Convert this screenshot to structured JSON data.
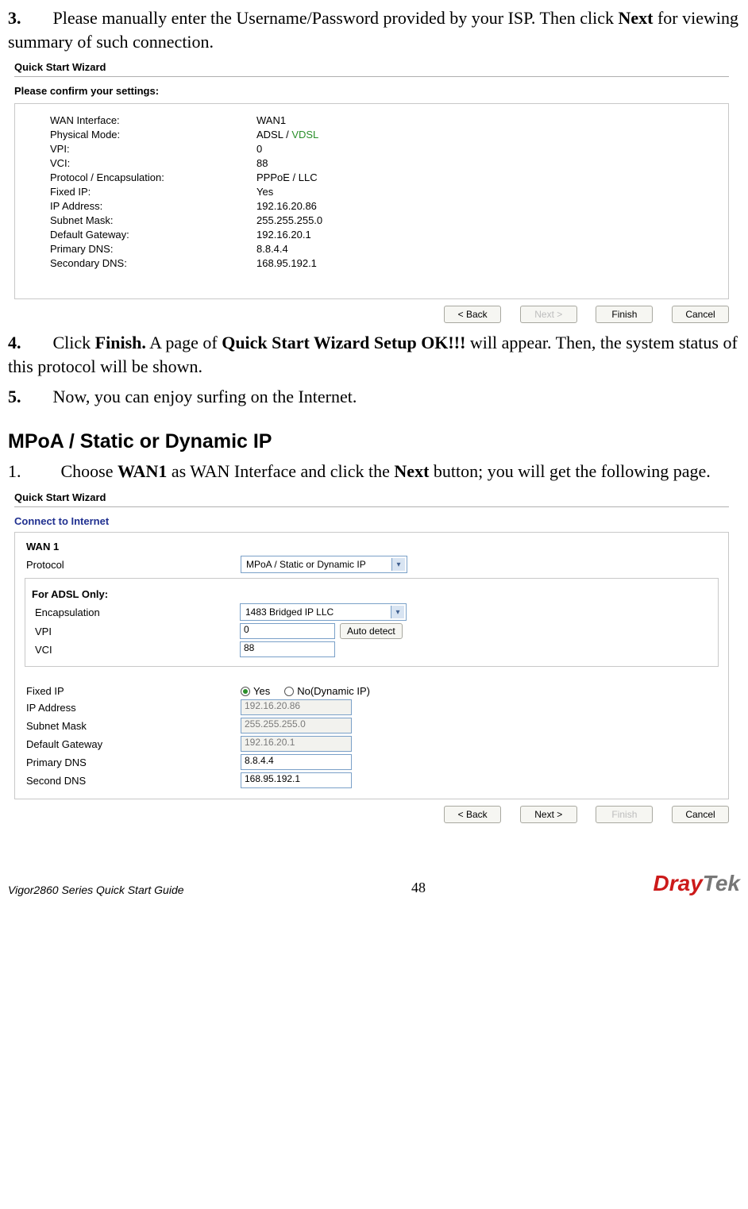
{
  "step3": {
    "num": "3.",
    "text_a": "Please manually enter the Username/Password provided by your ISP. Then click ",
    "bold": "Next",
    "text_b": " for viewing summary of such connection."
  },
  "shot1": {
    "title": "Quick Start Wizard",
    "confirm": "Please confirm your settings:",
    "rows": [
      {
        "k": "WAN Interface:",
        "v": "WAN1"
      },
      {
        "k": "Physical Mode:",
        "v": "ADSL / ",
        "vgreen": "VDSL"
      },
      {
        "k": "VPI:",
        "v": "0"
      },
      {
        "k": "VCI:",
        "v": "88"
      },
      {
        "k": "Protocol / Encapsulation:",
        "v": "PPPoE / LLC"
      },
      {
        "k": "Fixed IP:",
        "v": "Yes"
      },
      {
        "k": "IP Address:",
        "v": "192.16.20.86"
      },
      {
        "k": "Subnet Mask:",
        "v": "255.255.255.0"
      },
      {
        "k": "Default Gateway:",
        "v": "192.16.20.1"
      },
      {
        "k": "Primary DNS:",
        "v": "8.8.4.4"
      },
      {
        "k": "Secondary DNS:",
        "v": "168.95.192.1"
      }
    ],
    "buttons": {
      "back": "< Back",
      "next": "Next >",
      "finish": "Finish",
      "cancel": "Cancel"
    },
    "next_disabled": true,
    "finish_disabled": false
  },
  "step4": {
    "num": "4.",
    "a": "Click ",
    "b": "Finish.",
    "c": " A page of ",
    "d": "Quick Start Wizard Setup OK!!!",
    "e": " will appear. Then, the system status of this protocol will be shown."
  },
  "step5": {
    "num": "5.",
    "text": "Now, you can enjoy surfing on the Internet."
  },
  "section": "MPoA / Static or Dynamic IP",
  "step_m1": {
    "num": "1.",
    "a": "Choose ",
    "b": "WAN1",
    "c": " as WAN Interface and click the ",
    "d": "Next",
    "e": " button; you will get the following page."
  },
  "shot2": {
    "title": "Quick Start Wizard",
    "connect": "Connect to Internet",
    "wan": "WAN 1",
    "protocol_label": "Protocol",
    "protocol_value": "MPoA / Static or Dynamic IP",
    "adsl_only": "For ADSL Only:",
    "encap_label": "Encapsulation",
    "encap_value": "1483 Bridged IP LLC",
    "vpi_label": "VPI",
    "vpi_value": "0",
    "auto_detect": "Auto detect",
    "vci_label": "VCI",
    "vci_value": "88",
    "fixedip_label": "Fixed IP",
    "fixedip_yes": "Yes",
    "fixedip_no": "No(Dynamic IP)",
    "ip_label": "IP Address",
    "ip_value": "192.16.20.86",
    "mask_label": "Subnet Mask",
    "mask_value": "255.255.255.0",
    "gw_label": "Default Gateway",
    "gw_value": "192.16.20.1",
    "pdns_label": "Primary DNS",
    "pdns_value": "8.8.4.4",
    "sdns_label": "Second DNS",
    "sdns_value": "168.95.192.1",
    "buttons": {
      "back": "< Back",
      "next": "Next >",
      "finish": "Finish",
      "cancel": "Cancel"
    },
    "finish_disabled": true
  },
  "footer": {
    "guide": "Vigor2860 Series Quick Start Guide",
    "page": "48",
    "logo_a": "Dray",
    "logo_b": "Tek"
  }
}
